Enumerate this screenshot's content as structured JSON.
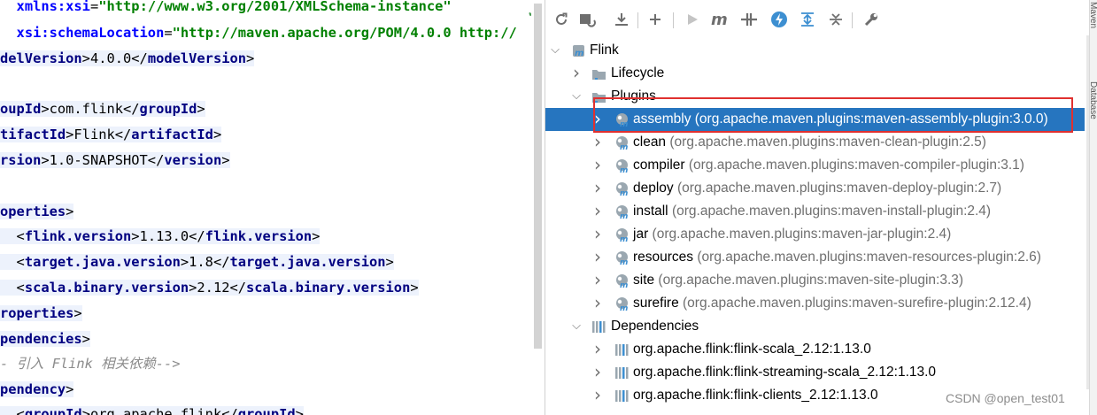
{
  "editor": {
    "lines": [
      {
        "parts": [
          {
            "t": "  ",
            "c": "txt"
          },
          {
            "t": "xmlns:xsi",
            "c": "attr"
          },
          {
            "t": "=",
            "c": "txt"
          },
          {
            "t": "\"http://www.w3.org/2001/XMLSchema-instance\"",
            "c": "str"
          }
        ]
      },
      {
        "parts": [
          {
            "t": "  ",
            "c": "txt"
          },
          {
            "t": "xsi:schemaLocation",
            "c": "attr"
          },
          {
            "t": "=",
            "c": "txt"
          },
          {
            "t": "\"http://maven.apache.org/POM/4.0.0 http://",
            "c": "str"
          }
        ]
      },
      {
        "parts": [
          {
            "t": "delVersion",
            "c": "tag"
          },
          {
            "t": ">4.0.0</",
            "c": "txt"
          },
          {
            "t": "modelVersion",
            "c": "tag"
          },
          {
            "t": ">",
            "c": "txt"
          }
        ]
      },
      {
        "parts": []
      },
      {
        "parts": [
          {
            "t": "oupId",
            "c": "tag"
          },
          {
            "t": ">com.flink</",
            "c": "txt"
          },
          {
            "t": "groupId",
            "c": "tag"
          },
          {
            "t": ">",
            "c": "txt"
          }
        ]
      },
      {
        "parts": [
          {
            "t": "tifactId",
            "c": "tag"
          },
          {
            "t": ">Flink</",
            "c": "txt"
          },
          {
            "t": "artifactId",
            "c": "tag"
          },
          {
            "t": ">",
            "c": "txt"
          }
        ]
      },
      {
        "parts": [
          {
            "t": "rsion",
            "c": "tag"
          },
          {
            "t": ">1.0-SNAPSHOT</",
            "c": "txt"
          },
          {
            "t": "version",
            "c": "tag"
          },
          {
            "t": ">",
            "c": "txt"
          }
        ]
      },
      {
        "parts": []
      },
      {
        "parts": [
          {
            "t": "operties",
            "c": "tag"
          },
          {
            "t": ">",
            "c": "txt"
          }
        ]
      },
      {
        "parts": [
          {
            "t": "  <",
            "c": "txt"
          },
          {
            "t": "flink.version",
            "c": "tag"
          },
          {
            "t": ">1.13.0</",
            "c": "txt"
          },
          {
            "t": "flink.version",
            "c": "tag"
          },
          {
            "t": ">",
            "c": "txt"
          }
        ]
      },
      {
        "parts": [
          {
            "t": "  <",
            "c": "txt"
          },
          {
            "t": "target.java.version",
            "c": "tag"
          },
          {
            "t": ">1.8</",
            "c": "txt"
          },
          {
            "t": "target.java.version",
            "c": "tag"
          },
          {
            "t": ">",
            "c": "txt"
          }
        ]
      },
      {
        "parts": [
          {
            "t": "  <",
            "c": "txt"
          },
          {
            "t": "scala.binary.version",
            "c": "tag"
          },
          {
            "t": ">2.12</",
            "c": "txt"
          },
          {
            "t": "scala.binary.version",
            "c": "tag"
          },
          {
            "t": ">",
            "c": "txt"
          }
        ]
      },
      {
        "parts": [
          {
            "t": "roperties",
            "c": "tag"
          },
          {
            "t": ">",
            "c": "txt"
          }
        ]
      },
      {
        "parts": [
          {
            "t": "pendencies",
            "c": "tag"
          },
          {
            "t": ">",
            "c": "txt"
          }
        ]
      },
      {
        "parts": [
          {
            "t": "- 引入 Flink 相关依赖-->",
            "c": "cmt"
          }
        ]
      },
      {
        "parts": [
          {
            "t": "pendency",
            "c": "tag"
          },
          {
            "t": ">",
            "c": "txt"
          }
        ]
      },
      {
        "parts": [
          {
            "t": "  <",
            "c": "txt"
          },
          {
            "t": "groupId",
            "c": "tag"
          },
          {
            "t": ">org.apache.flink</",
            "c": "txt"
          },
          {
            "t": "groupId",
            "c": "tag"
          },
          {
            "t": ">",
            "c": "txt"
          }
        ]
      }
    ]
  },
  "maven": {
    "toolbar": [
      {
        "name": "reload-icon",
        "glyph": "⟳"
      },
      {
        "name": "generate-sources-icon",
        "glyph": "⇅"
      },
      {
        "name": "download-icon",
        "glyph": "⤓"
      },
      {
        "name": "add-icon",
        "glyph": "+"
      },
      {
        "name": "run-icon",
        "glyph": "▶"
      },
      {
        "name": "execute-goal-icon",
        "glyph": "m"
      },
      {
        "name": "toggle-offline-icon",
        "glyph": "⫲"
      },
      {
        "name": "skip-tests-icon",
        "glyph": "ϟ"
      },
      {
        "name": "show-dependencies-icon",
        "glyph": "⊤"
      },
      {
        "name": "collapse-all-icon",
        "glyph": "⊥"
      },
      {
        "name": "settings-wrench-icon",
        "glyph": "🔧"
      }
    ],
    "tree": [
      {
        "name": "tree-project-flink",
        "level": 0,
        "arrow": "expanded",
        "icon": "project",
        "label": "Flink",
        "coord": ""
      },
      {
        "name": "tree-lifecycle",
        "level": 1,
        "arrow": "collapsed",
        "icon": "folder",
        "label": "Lifecycle",
        "coord": ""
      },
      {
        "name": "tree-plugins",
        "level": 1,
        "arrow": "expanded",
        "icon": "folder",
        "label": "Plugins",
        "coord": ""
      },
      {
        "name": "tree-plugin-assembly",
        "level": 2,
        "arrow": "collapsed",
        "icon": "plugin",
        "label": "assembly",
        "coord": " (org.apache.maven.plugins:maven-assembly-plugin:3.0.0)",
        "selected": true
      },
      {
        "name": "tree-plugin-clean",
        "level": 2,
        "arrow": "collapsed",
        "icon": "plugin",
        "label": "clean",
        "coord": " (org.apache.maven.plugins:maven-clean-plugin:2.5)"
      },
      {
        "name": "tree-plugin-compiler",
        "level": 2,
        "arrow": "collapsed",
        "icon": "plugin",
        "label": "compiler",
        "coord": " (org.apache.maven.plugins:maven-compiler-plugin:3.1)"
      },
      {
        "name": "tree-plugin-deploy",
        "level": 2,
        "arrow": "collapsed",
        "icon": "plugin",
        "label": "deploy",
        "coord": " (org.apache.maven.plugins:maven-deploy-plugin:2.7)"
      },
      {
        "name": "tree-plugin-install",
        "level": 2,
        "arrow": "collapsed",
        "icon": "plugin",
        "label": "install",
        "coord": " (org.apache.maven.plugins:maven-install-plugin:2.4)"
      },
      {
        "name": "tree-plugin-jar",
        "level": 2,
        "arrow": "collapsed",
        "icon": "plugin",
        "label": "jar",
        "coord": " (org.apache.maven.plugins:maven-jar-plugin:2.4)"
      },
      {
        "name": "tree-plugin-resources",
        "level": 2,
        "arrow": "collapsed",
        "icon": "plugin",
        "label": "resources",
        "coord": " (org.apache.maven.plugins:maven-resources-plugin:2.6)"
      },
      {
        "name": "tree-plugin-site",
        "level": 2,
        "arrow": "collapsed",
        "icon": "plugin",
        "label": "site",
        "coord": " (org.apache.maven.plugins:maven-site-plugin:3.3)"
      },
      {
        "name": "tree-plugin-surefire",
        "level": 2,
        "arrow": "collapsed",
        "icon": "plugin",
        "label": "surefire",
        "coord": " (org.apache.maven.plugins:maven-surefire-plugin:2.12.4)"
      },
      {
        "name": "tree-dependencies",
        "level": 1,
        "arrow": "expanded",
        "icon": "library",
        "label": "Dependencies",
        "coord": ""
      },
      {
        "name": "tree-dep-flink-scala",
        "level": 2,
        "arrow": "collapsed",
        "icon": "library",
        "label": "org.apache.flink:flink-scala_2.12:1.13.0",
        "coord": ""
      },
      {
        "name": "tree-dep-flink-streaming-scala",
        "level": 2,
        "arrow": "collapsed",
        "icon": "library",
        "label": "org.apache.flink:flink-streaming-scala_2.12:1.13.0",
        "coord": ""
      },
      {
        "name": "tree-dep-flink-clients",
        "level": 2,
        "arrow": "collapsed",
        "icon": "library",
        "label": "org.apache.flink:flink-clients_2.12:1.13.0",
        "coord": ""
      }
    ]
  },
  "side_strip": {
    "top_label": "Maven",
    "second_label": "Database"
  },
  "watermark": "CSDN @open_test01",
  "colors": {
    "selection": "#2675bf",
    "highlight_border": "#e0302f",
    "xml_tag": "#000080",
    "xml_attr": "#0000ff",
    "xml_string": "#008000"
  }
}
